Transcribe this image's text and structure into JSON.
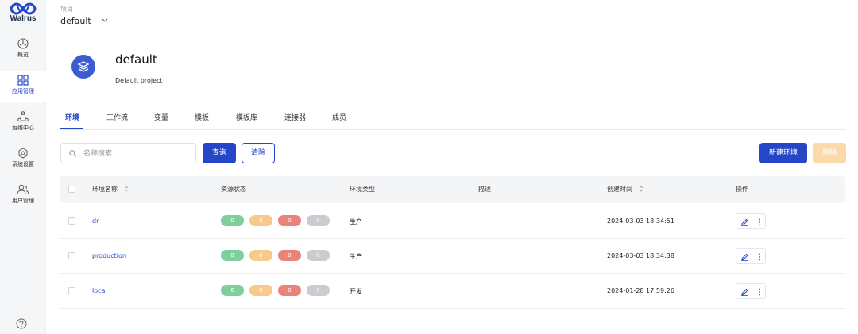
{
  "brand": {
    "name": "Walrus"
  },
  "sidebar": {
    "items": [
      {
        "label": "概览",
        "icon": "dashboard-icon"
      },
      {
        "label": "应用管理",
        "icon": "apps-grid-icon",
        "active": true
      },
      {
        "label": "运维中心",
        "icon": "ops-center-icon"
      },
      {
        "label": "系统设置",
        "icon": "gear-icon"
      },
      {
        "label": "用户管理",
        "icon": "users-icon"
      }
    ],
    "help_icon": "help-circle-icon"
  },
  "header": {
    "project_label": "项目",
    "project_value": "default"
  },
  "project": {
    "title": "default",
    "description": "Default project",
    "icon": "layers-icon"
  },
  "tabs": [
    {
      "label": "环境",
      "active": true
    },
    {
      "label": "工作流"
    },
    {
      "label": "变量"
    },
    {
      "label": "模板"
    },
    {
      "label": "模板库"
    },
    {
      "label": "连接器"
    },
    {
      "label": "成员"
    }
  ],
  "toolbar": {
    "search_placeholder": "名称搜索",
    "search_value": "",
    "query_label": "查询",
    "clear_label": "清除",
    "new_env_label": "新建环境",
    "delete_label": "删除"
  },
  "table": {
    "columns": [
      "环境名称",
      "资源状态",
      "环境类型",
      "描述",
      "创建时间",
      "操作"
    ],
    "status_colors": [
      "#7fcf9a",
      "#f7c98a",
      "#ec827c",
      "#c9ccd1"
    ],
    "rows": [
      {
        "name": "dr",
        "status": [
          "0",
          "0",
          "0",
          "0"
        ],
        "type": "生产",
        "description": "",
        "created": "2024-03-03 18:34:51"
      },
      {
        "name": "production",
        "status": [
          "0",
          "0",
          "0",
          "0"
        ],
        "type": "生产",
        "description": "",
        "created": "2024-03-03 18:34:38"
      },
      {
        "name": "local",
        "status": [
          "6",
          "0",
          "0",
          "0"
        ],
        "type": "开发",
        "description": "",
        "created": "2024-01-28 17:59:26"
      }
    ]
  },
  "colors": {
    "primary": "#2546c6",
    "disabled": "#fbd9a8"
  }
}
